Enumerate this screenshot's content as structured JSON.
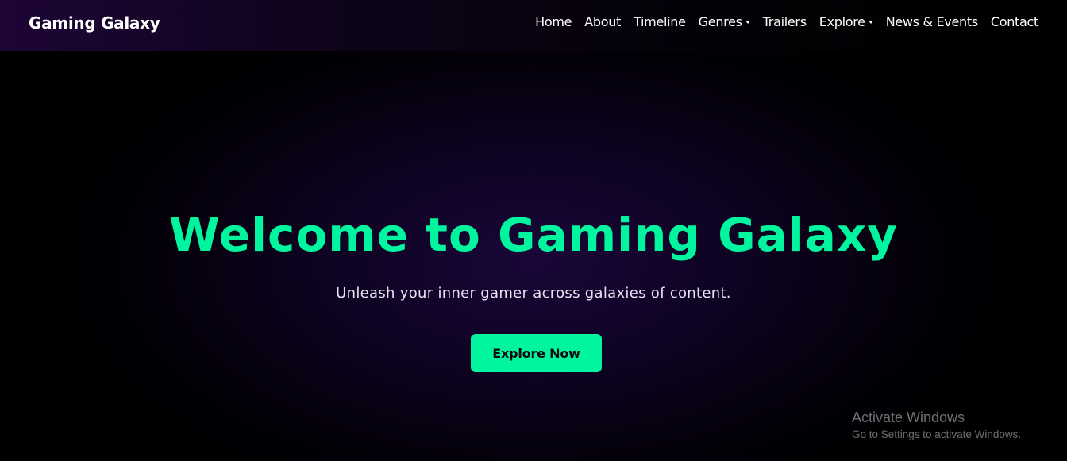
{
  "navbar": {
    "brand": "Gaming Galaxy",
    "items": [
      {
        "label": "Home",
        "dropdown": false
      },
      {
        "label": "About",
        "dropdown": false
      },
      {
        "label": "Timeline",
        "dropdown": false
      },
      {
        "label": "Genres",
        "dropdown": true
      },
      {
        "label": "Trailers",
        "dropdown": false
      },
      {
        "label": "Explore",
        "dropdown": true
      },
      {
        "label": "News & Events",
        "dropdown": false
      },
      {
        "label": "Contact",
        "dropdown": false
      }
    ]
  },
  "hero": {
    "title": "Welcome to Gaming Galaxy",
    "subtitle": "Unleash your inner gamer across galaxies of content.",
    "cta_label": "Explore Now"
  },
  "overlay": {
    "activate_title": "Activate Windows",
    "activate_subtitle": "Go to Settings to activate Windows."
  },
  "colors": {
    "accent": "#00f59e",
    "background": "#000000",
    "nav_gradient_start": "#1d0535",
    "hero_glow": "#1a0638"
  }
}
